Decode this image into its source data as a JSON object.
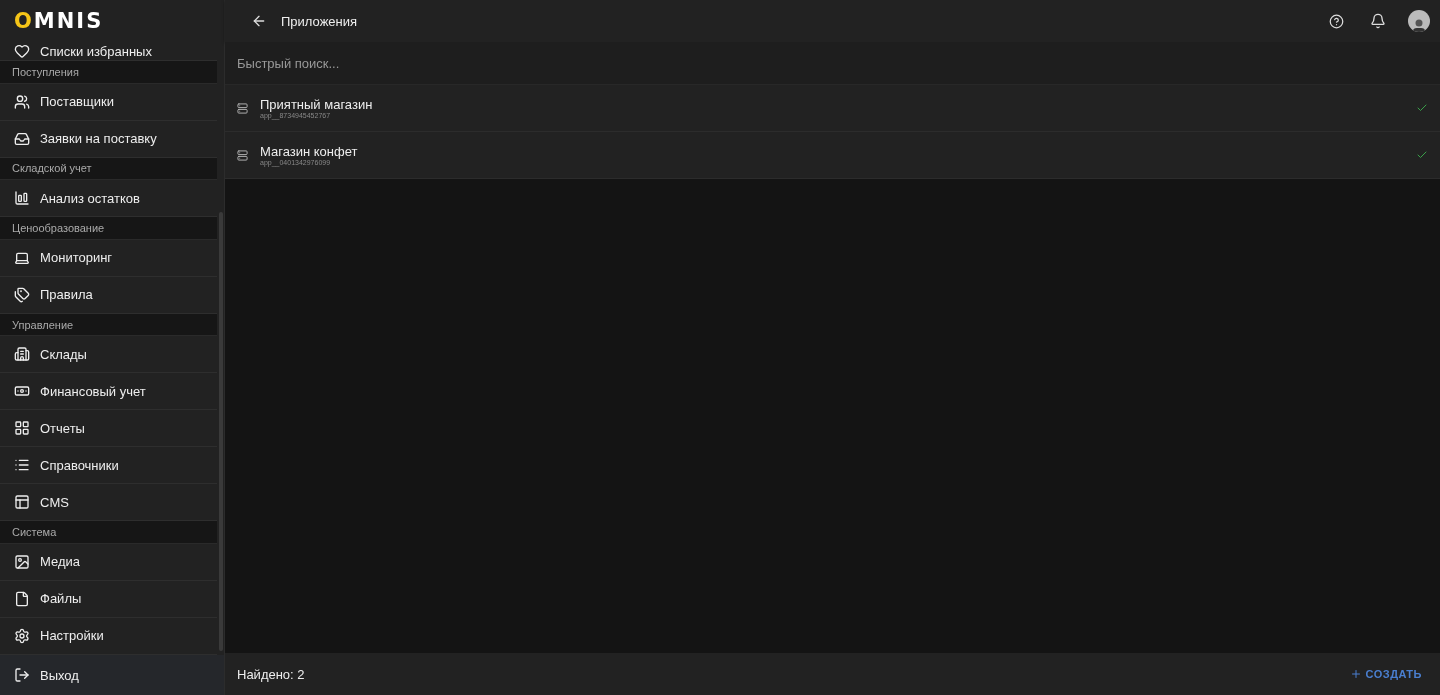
{
  "logo": "OMNIS",
  "sidebar": {
    "items": [
      {
        "kind": "item",
        "label": "Списки избранных"
      },
      {
        "kind": "group",
        "label": "Поступления"
      },
      {
        "kind": "item",
        "label": "Поставщики"
      },
      {
        "kind": "item",
        "label": "Заявки на поставку"
      },
      {
        "kind": "group",
        "label": "Складской учет"
      },
      {
        "kind": "item",
        "label": "Анализ остатков"
      },
      {
        "kind": "group",
        "label": "Ценообразование"
      },
      {
        "kind": "item",
        "label": "Мониторинг"
      },
      {
        "kind": "item",
        "label": "Правила"
      },
      {
        "kind": "group",
        "label": "Управление"
      },
      {
        "kind": "item",
        "label": "Склады"
      },
      {
        "kind": "item",
        "label": "Финансовый учет"
      },
      {
        "kind": "item",
        "label": "Отчеты"
      },
      {
        "kind": "item",
        "label": "Справочники"
      },
      {
        "kind": "item",
        "label": "CMS"
      },
      {
        "kind": "group",
        "label": "Система"
      },
      {
        "kind": "item",
        "label": "Медиа"
      },
      {
        "kind": "item",
        "label": "Файлы"
      },
      {
        "kind": "item",
        "label": "Настройки"
      }
    ],
    "logout": "Выход"
  },
  "header": {
    "title": "Приложения"
  },
  "search": {
    "placeholder": "Быстрый поиск..."
  },
  "apps": [
    {
      "name": "Приятный магазин",
      "id": "app__8734945452767",
      "active": true
    },
    {
      "name": "Магазин конфет",
      "id": "app__0401342976099",
      "active": true
    }
  ],
  "footer": {
    "found": "Найдено: 2",
    "create": "СОЗДАТЬ"
  }
}
